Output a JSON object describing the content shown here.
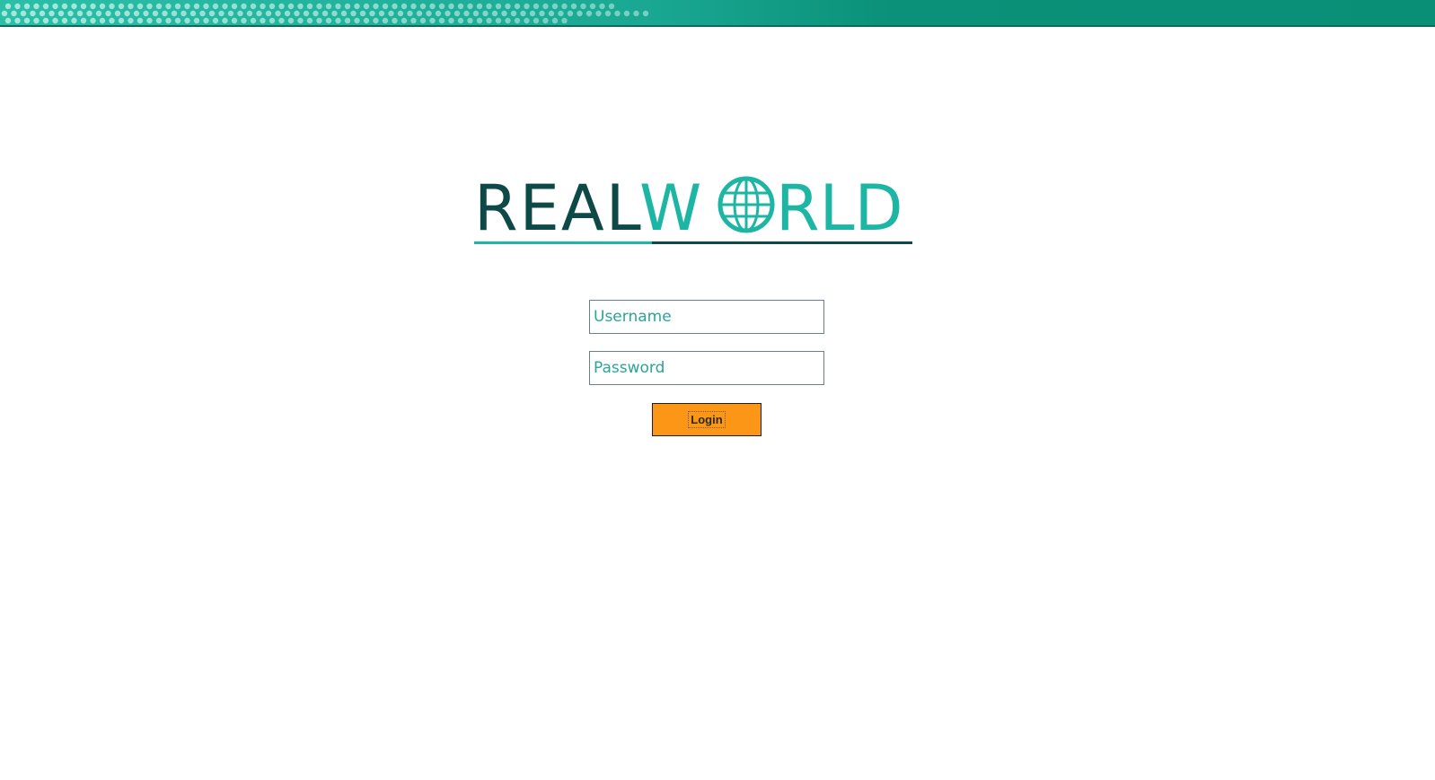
{
  "brand": {
    "logo_text_dark": "REAL",
    "logo_text_light": "WRLD",
    "logo_text_light_prefix": "W",
    "logo_text_light_suffix": "RLD",
    "colors": {
      "dark_teal": "#0d4a47",
      "light_teal": "#1db5a3",
      "button_orange": "#fb9617"
    }
  },
  "login_form": {
    "username": {
      "placeholder": "Username",
      "value": ""
    },
    "password": {
      "placeholder": "Password",
      "value": ""
    },
    "submit_label": "Login"
  },
  "icons": {
    "logo_globe": "globe-icon"
  }
}
